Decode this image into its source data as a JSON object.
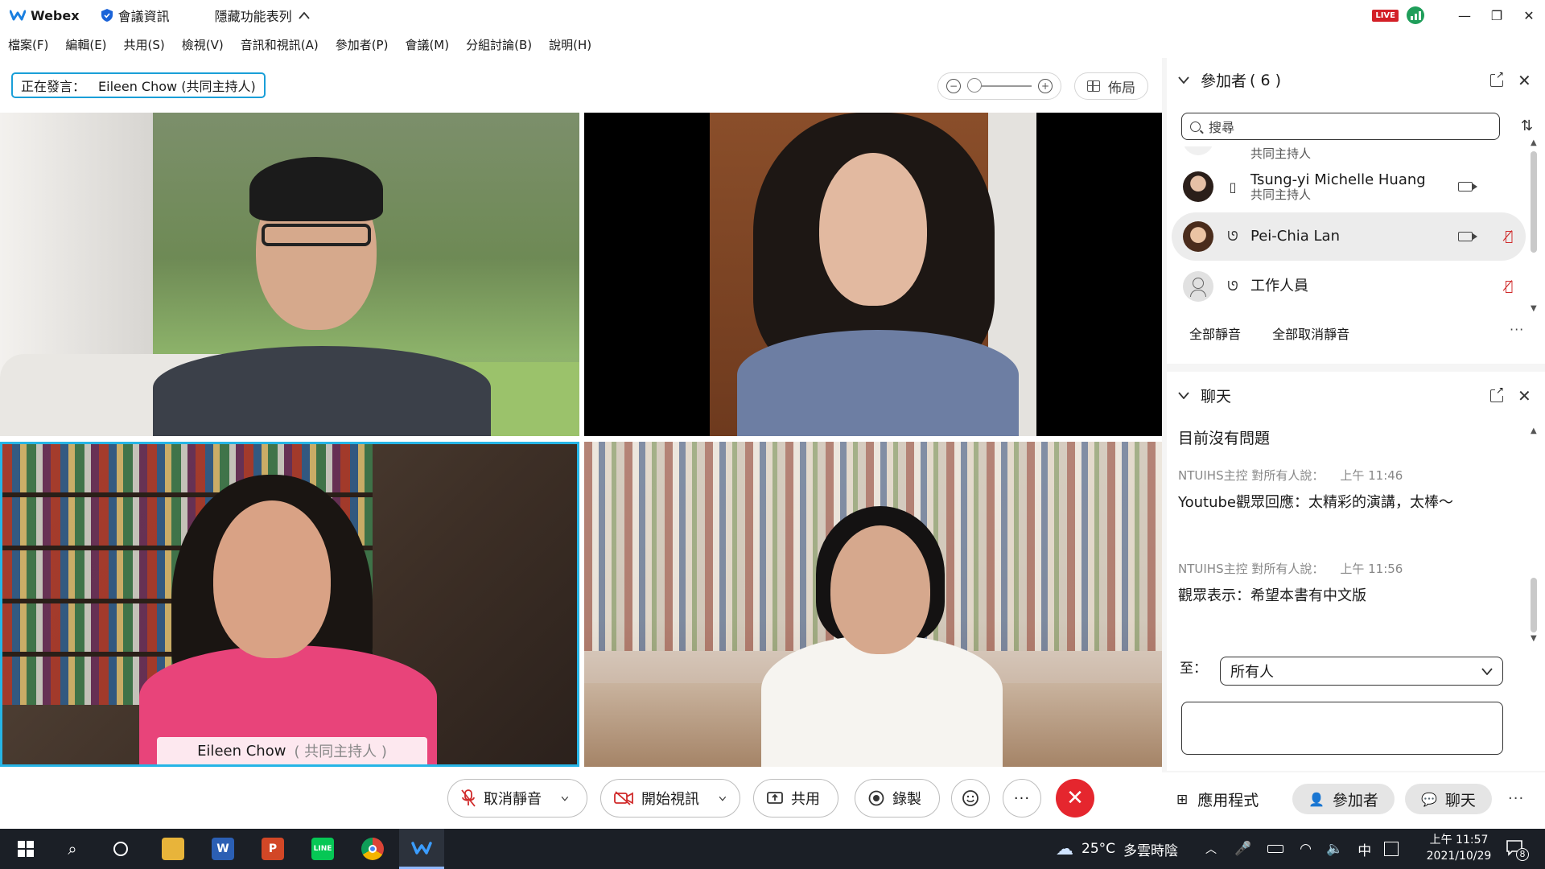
{
  "titlebar": {
    "app_name": "Webex",
    "meeting_info": "會議資訊",
    "hide_menu": "隱藏功能表列",
    "live_badge": "LIVE"
  },
  "menubar": {
    "items": [
      "檔案(F)",
      "編輯(E)",
      "共用(S)",
      "檢視(V)",
      "音訊和視訊(A)",
      "參加者(P)",
      "會議(M)",
      "分組討論(B)",
      "說明(H)"
    ]
  },
  "speaker": {
    "label": "正在發言：",
    "name": "Eileen Chow (共同主持人)"
  },
  "layout_button": "佈局",
  "video_tiles": [
    {
      "name": "",
      "role": ""
    },
    {
      "name": "",
      "role": ""
    },
    {
      "name": "Eileen Chow",
      "role": "( 共同主持人 )"
    },
    {
      "name": "",
      "role": ""
    }
  ],
  "participants": {
    "title": "參加者",
    "count": "( 6 )",
    "search_placeholder": "搜尋",
    "partial_row_sub": "共同主持人",
    "rows": [
      {
        "name": "Tsung-yi Michelle Huang",
        "sub": "共同主持人",
        "selected": false
      },
      {
        "name": "Pei-Chia Lan",
        "sub": "",
        "selected": true
      },
      {
        "name": "工作人員",
        "sub": "",
        "selected": false
      }
    ],
    "mute_all": "全部靜音",
    "unmute_all": "全部取消靜音"
  },
  "chat": {
    "title": "聊天",
    "no_questions": "目前沒有問題",
    "messages": [
      {
        "sender": "NTUIHS主控 對所有人說：",
        "time": "上午 11:46",
        "text": "Youtube觀眾回應：太精彩的演講，太棒～"
      },
      {
        "sender": "NTUIHS主控 對所有人說：",
        "time": "上午 11:56",
        "text": "觀眾表示：希望本書有中文版"
      }
    ],
    "to_label": "至：",
    "to_value": "所有人"
  },
  "controls": {
    "unmute": "取消靜音",
    "start_video": "開始視訊",
    "share": "共用",
    "record": "錄製",
    "apps": "應用程式",
    "participants": "參加者",
    "chat": "聊天"
  },
  "taskbar": {
    "weather_temp": "25°C",
    "weather_desc": "多雲時陰",
    "ime": "中",
    "time": "上午 11:57",
    "date": "2021/10/29",
    "notifications": "8"
  },
  "colors": {
    "active_speaker_border": "#26b5e6",
    "end_call": "#e5262e",
    "mute_red": "#d02a2a",
    "live": "#d32027",
    "taskbar": "#1b1f26"
  }
}
